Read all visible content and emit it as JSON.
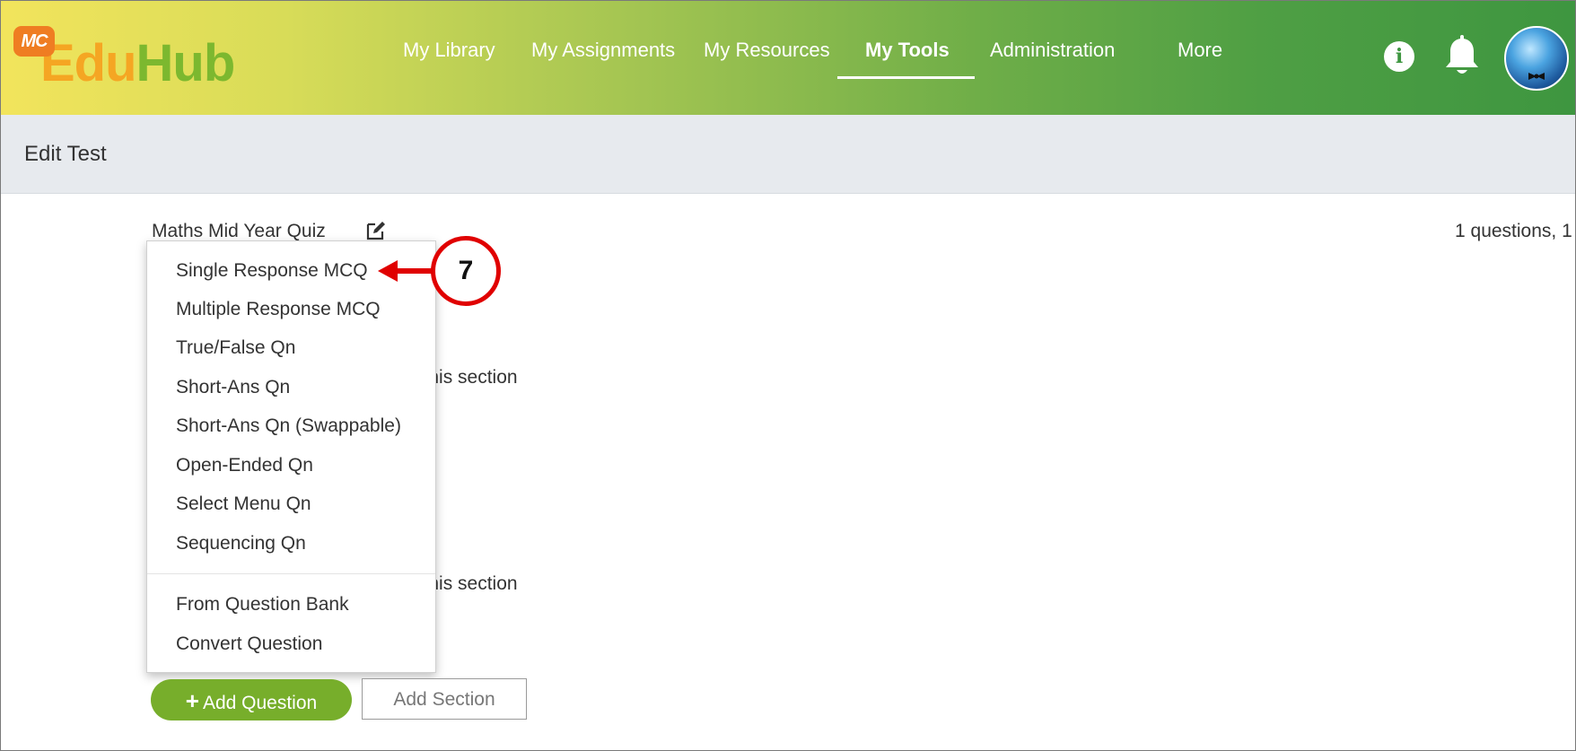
{
  "app": {
    "logo_badge": "MC",
    "logo_edu": "Edu",
    "logo_hub": "Hub"
  },
  "nav": {
    "items": [
      {
        "label": "My Library"
      },
      {
        "label": "My Assignments"
      },
      {
        "label": "My Resources"
      },
      {
        "label": "My Tools",
        "active": true
      },
      {
        "label": "Administration"
      },
      {
        "label": "More"
      }
    ]
  },
  "header_icons": {
    "info": "i",
    "info_icon": "info-icon",
    "bell_icon": "bell-icon",
    "avatar_icon": "avatar"
  },
  "page": {
    "title": "Edit Test"
  },
  "test": {
    "name": "Maths Mid Year Quiz",
    "summary": "1 questions, 1"
  },
  "sections": [
    {
      "text": "n this section"
    },
    {
      "text": "n this section"
    }
  ],
  "dropdown": {
    "items": [
      "Single Response MCQ",
      "Multiple Response MCQ",
      "True/False Qn",
      "Short-Ans Qn",
      "Short-Ans Qn (Swappable)",
      "Open-Ended Qn",
      "Select Menu Qn",
      "Sequencing Qn"
    ],
    "extra_items": [
      "From Question Bank",
      "Convert Question"
    ]
  },
  "buttons": {
    "add_question": "Add Question",
    "add_question_plus": "+",
    "add_section": "Add Section"
  },
  "annotation": {
    "step": "7",
    "color": "#e00000"
  },
  "colors": {
    "primary_green": "#77ae2b",
    "header_start": "#f2e45c",
    "header_end": "#3e9640"
  }
}
